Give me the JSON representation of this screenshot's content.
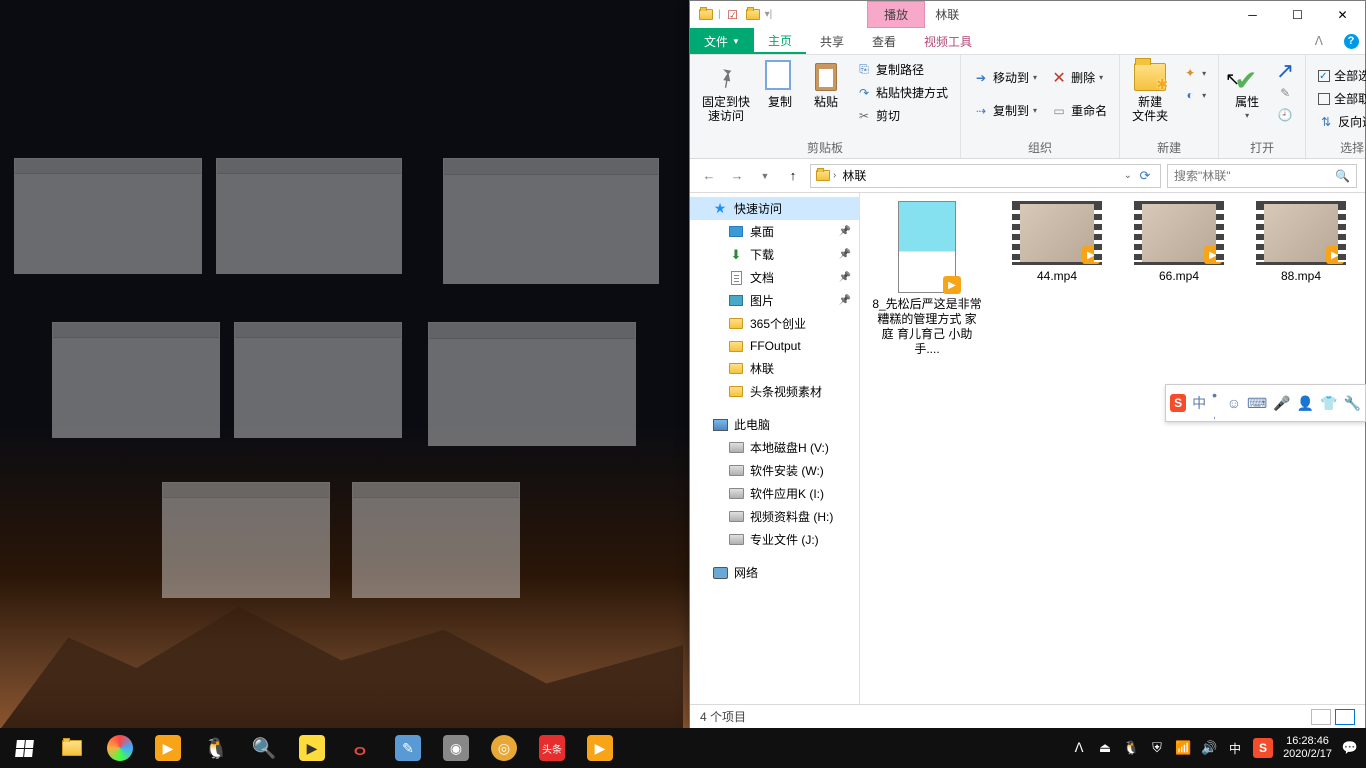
{
  "colors": {
    "accent": "#00a971",
    "context": "#f8a8c8"
  },
  "window": {
    "context_tab": "播放",
    "title": "林联",
    "tabs": {
      "file": "文件",
      "home": "主页",
      "share": "共享",
      "view": "查看",
      "video_tools": "视频工具"
    },
    "ribbon": {
      "clipboard": {
        "label": "剪贴板",
        "pin": "固定到快\n速访问",
        "copy": "复制",
        "paste": "粘贴",
        "copy_path": "复制路径",
        "paste_shortcut": "粘贴快捷方式",
        "cut": "剪切"
      },
      "organize": {
        "label": "组织",
        "move_to": "移动到",
        "copy_to": "复制到",
        "delete": "删除",
        "rename": "重命名"
      },
      "new": {
        "label": "新建",
        "new_folder": "新建\n文件夹"
      },
      "open": {
        "label": "打开",
        "properties": "属性"
      },
      "select": {
        "label": "选择",
        "select_all": "全部选择",
        "select_none": "全部取消",
        "invert": "反向选择"
      }
    },
    "breadcrumb": {
      "current": "林联"
    },
    "search_placeholder": "搜索\"林联\"",
    "status": "4 个项目"
  },
  "nav_pane": {
    "quick_access": "快速访问",
    "items_pinned": [
      {
        "label": "桌面",
        "icon": "desktop"
      },
      {
        "label": "下载",
        "icon": "download"
      },
      {
        "label": "文档",
        "icon": "document"
      },
      {
        "label": "图片",
        "icon": "picture"
      }
    ],
    "items_recent": [
      {
        "label": "365个创业"
      },
      {
        "label": "FFOutput"
      },
      {
        "label": "林联"
      },
      {
        "label": "头条视频素材"
      }
    ],
    "this_pc": "此电脑",
    "drives": [
      {
        "label": "本地磁盘H (V:)"
      },
      {
        "label": "软件安装 (W:)"
      },
      {
        "label": "软件应用K (I:)"
      },
      {
        "label": "视频资料盘 (H:)"
      },
      {
        "label": "专业文件 (J:)"
      }
    ],
    "network": "网络"
  },
  "files": [
    {
      "name": "8_先松后严这是非常糟糕的管理方式 家庭  育儿育己  小助手....",
      "kind": "video-portrait"
    },
    {
      "name": "44.mp4",
      "kind": "video"
    },
    {
      "name": "66.mp4",
      "kind": "video"
    },
    {
      "name": "88.mp4",
      "kind": "video"
    }
  ],
  "ime": {
    "mode": "中"
  },
  "tray": {
    "lang": "中",
    "time": "16:28:46",
    "date": "2020/2/17"
  }
}
